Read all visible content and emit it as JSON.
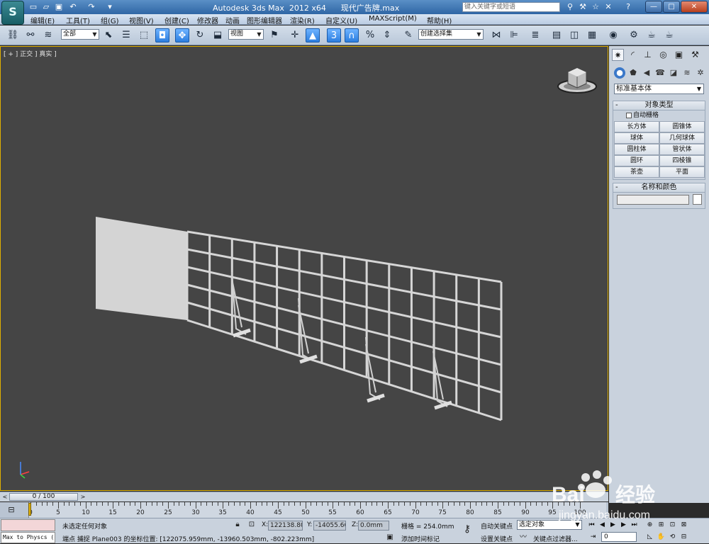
{
  "title_bar": {
    "app_logo": "S",
    "title": "Autodesk 3ds Max  2012 x64      现代广告牌.max",
    "search_placeholder": "键入关键字或短语",
    "quick_access_icons": [
      "new-file-icon",
      "open-file-icon",
      "save-icon",
      "undo-icon",
      "redo-icon",
      "customize-icon"
    ],
    "right_icons": [
      "binoculars-icon",
      "wrench-icon",
      "star-icon",
      "close-icon",
      "help-icon"
    ],
    "window_buttons": {
      "minimize": "—",
      "maximize": "□",
      "close": "✕"
    }
  },
  "menu": {
    "items": [
      "编辑(E)",
      "工具(T)",
      "组(G)",
      "视图(V)",
      "创建(C)",
      "修改器",
      "动画",
      "图形编辑器",
      "渲染(R)",
      "自定义(U)",
      "MAXScript(M)",
      "帮助(H)"
    ]
  },
  "toolbar": {
    "selection_filter": "全部",
    "reference_coord": "视图",
    "named_selection": "创建选择集",
    "snap_label": "3"
  },
  "viewport": {
    "label": "[ + ] 正交 ] 真实 ]"
  },
  "command_panel": {
    "category": "标准基本体",
    "object_type_title": "对象类型",
    "autogrid_label": "自动栅格",
    "primitives": [
      "长方体",
      "圆锥体",
      "球体",
      "几何球体",
      "圆柱体",
      "管状体",
      "圆环",
      "四棱锥",
      "茶壶",
      "平面"
    ],
    "name_color_title": "名称和颜色",
    "name_value": "",
    "swatch_color": "#ffffff"
  },
  "time_slider": {
    "position_label": "0 / 100"
  },
  "track_bar": {
    "tick_labels": [
      "0",
      "5",
      "10",
      "15",
      "20",
      "25",
      "30",
      "35",
      "40",
      "45",
      "50",
      "55",
      "60",
      "65",
      "70",
      "75",
      "80",
      "85",
      "90",
      "95",
      "100"
    ]
  },
  "status_bar": {
    "maxscript_text": "Max to Physcs (",
    "selection_status": "未选定任何对象",
    "prompt": "端点 捕捉 Plane003 的坐标位置:  [122075.959mm, -13960.503mm, -802.223mm]",
    "x_label": "X:",
    "x_value": "122138.80",
    "y_label": "Y:",
    "y_value": "-14055.66",
    "z_label": "Z:",
    "z_value": "0.0mm",
    "grid_label": "栅格 = 254.0mm",
    "add_time_tag": "添加时间标记",
    "auto_key": "自动关键点",
    "set_key": "设置关键点",
    "key_mode": "选定对象",
    "key_filters": "关键点过滤器...",
    "current_frame": "0"
  },
  "colors": {
    "viewport_bg": "#454545",
    "viewport_border": "#e0b000",
    "active_tool": "#2b7de0",
    "model_color": "#d9d9d9"
  }
}
